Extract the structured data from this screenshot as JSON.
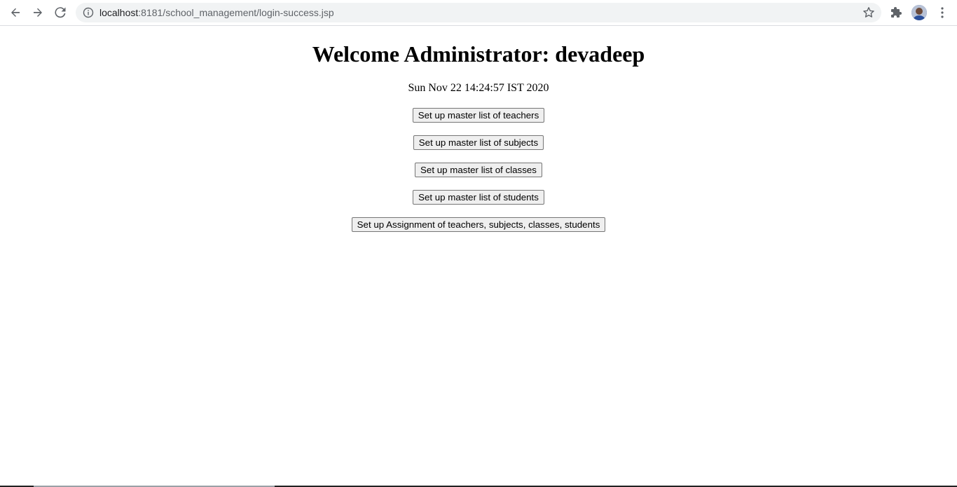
{
  "browser": {
    "url_host": "localhost",
    "url_rest": ":8181/school_management/login-success.jsp"
  },
  "page": {
    "heading": "Welcome Administrator: devadeep",
    "datetime": "Sun Nov 22 14:24:57 IST 2020",
    "buttons": [
      "Set up master list of teachers",
      "Set up master list of subjects",
      "Set up master list of classes",
      "Set up master list of students",
      "Set up Assignment of teachers, subjects, classes, students"
    ]
  },
  "icons": {
    "back": "back-arrow-icon",
    "forward": "forward-arrow-icon",
    "reload": "reload-icon",
    "info": "info-icon",
    "bookmark": "star-icon",
    "extensions": "puzzle-icon",
    "profile": "avatar",
    "menu": "kebab-menu-icon"
  }
}
